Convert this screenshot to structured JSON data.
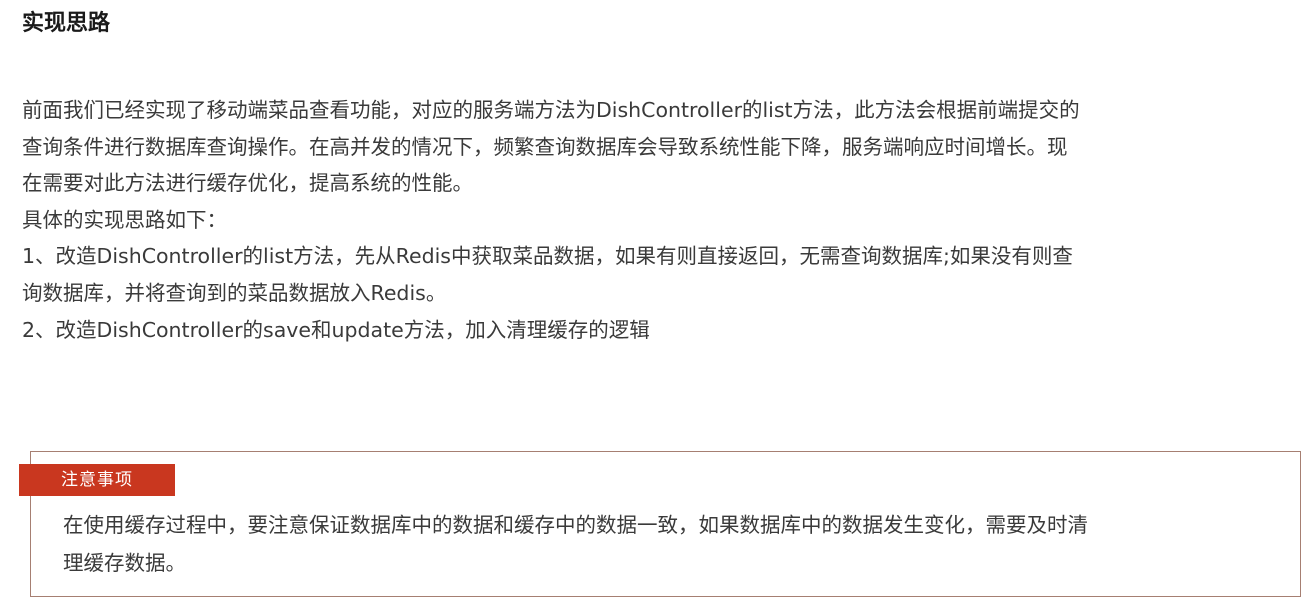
{
  "heading": "实现思路",
  "intro_lines": [
    "前面我们已经实现了移动端菜品查看功能，对应的服务端方法为DishController的list方法，此方法会根据前端提交的",
    "查询条件进行数据库查询操作。在高并发的情况下，频繁查询数据库会导致系统性能下降，服务端响应时间增长。现",
    "在需要对此方法进行缓存优化，提高系统的性能。",
    "具体的实现思路如下：",
    "1、改造DishController的list方法，先从Redis中获取菜品数据，如果有则直接返回，无需查询数据库;如果没有则查",
    "询数据库，并将查询到的菜品数据放入Redis。",
    "2、改造DishController的save和update方法，加入清理缓存的逻辑"
  ],
  "notice": {
    "tag": "注意事项",
    "lines": [
      "在使用缓存过程中，要注意保证数据库中的数据和缓存中的数据一致，如果数据库中的数据发生变化，需要及时清",
      "理缓存数据。"
    ]
  },
  "colors": {
    "tag_background": "#c9371f",
    "box_border": "#a67f72",
    "text": "#3a3a3a"
  }
}
